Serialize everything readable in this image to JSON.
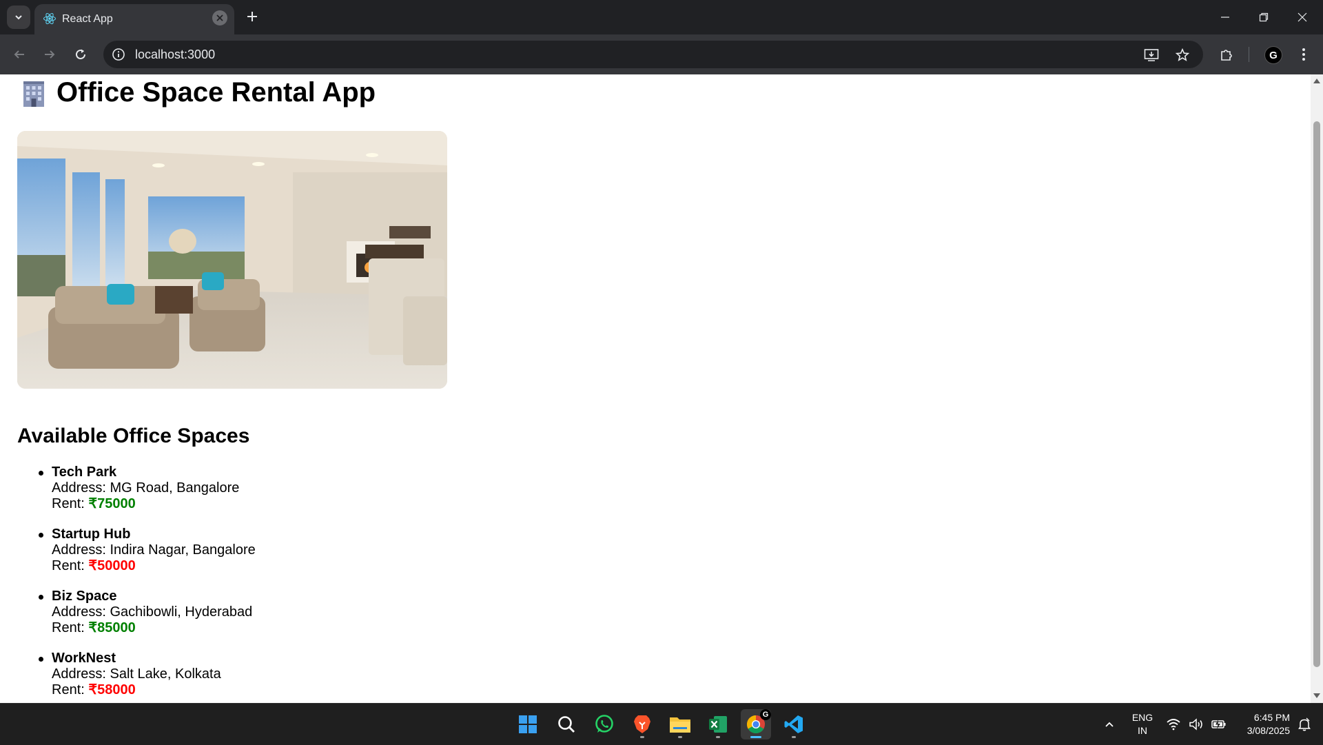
{
  "browser": {
    "tab_title": "React App",
    "url": "localhost:3000",
    "profile_initial": "G"
  },
  "page": {
    "title": "Office Space Rental App",
    "section_title": "Available Office Spaces",
    "address_prefix": "Address: ",
    "rent_prefix": "Rent: ",
    "spaces": [
      {
        "name": "Tech Park",
        "address": "MG Road, Bangalore",
        "rent": "₹75000",
        "rent_color": "#008000"
      },
      {
        "name": "Startup Hub",
        "address": "Indira Nagar, Bangalore",
        "rent": "₹50000",
        "rent_color": "#ff0000"
      },
      {
        "name": "Biz Space",
        "address": "Gachibowli, Hyderabad",
        "rent": "₹85000",
        "rent_color": "#008000"
      },
      {
        "name": "WorkNest",
        "address": "Salt Lake, Kolkata",
        "rent": "₹58000",
        "rent_color": "#ff0000"
      }
    ]
  },
  "taskbar": {
    "language": "ENG",
    "region": "IN",
    "time": "6:45 PM",
    "date": "3/08/2025",
    "chrome_badge": "G"
  }
}
